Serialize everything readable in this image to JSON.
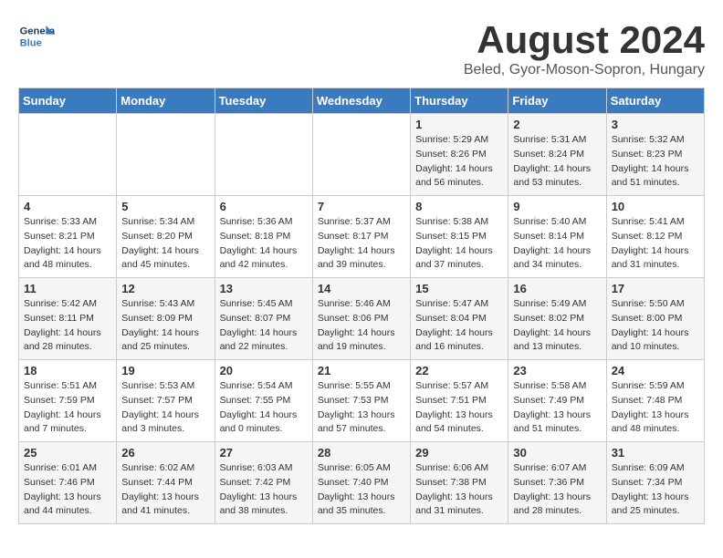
{
  "header": {
    "logo_line1": "General",
    "logo_line2": "Blue",
    "title": "August 2024",
    "subtitle": "Beled, Gyor-Moson-Sopron, Hungary"
  },
  "weekdays": [
    "Sunday",
    "Monday",
    "Tuesday",
    "Wednesday",
    "Thursday",
    "Friday",
    "Saturday"
  ],
  "weeks": [
    [
      {
        "day": "",
        "info": ""
      },
      {
        "day": "",
        "info": ""
      },
      {
        "day": "",
        "info": ""
      },
      {
        "day": "",
        "info": ""
      },
      {
        "day": "1",
        "info": "Sunrise: 5:29 AM\nSunset: 8:26 PM\nDaylight: 14 hours\nand 56 minutes."
      },
      {
        "day": "2",
        "info": "Sunrise: 5:31 AM\nSunset: 8:24 PM\nDaylight: 14 hours\nand 53 minutes."
      },
      {
        "day": "3",
        "info": "Sunrise: 5:32 AM\nSunset: 8:23 PM\nDaylight: 14 hours\nand 51 minutes."
      }
    ],
    [
      {
        "day": "4",
        "info": "Sunrise: 5:33 AM\nSunset: 8:21 PM\nDaylight: 14 hours\nand 48 minutes."
      },
      {
        "day": "5",
        "info": "Sunrise: 5:34 AM\nSunset: 8:20 PM\nDaylight: 14 hours\nand 45 minutes."
      },
      {
        "day": "6",
        "info": "Sunrise: 5:36 AM\nSunset: 8:18 PM\nDaylight: 14 hours\nand 42 minutes."
      },
      {
        "day": "7",
        "info": "Sunrise: 5:37 AM\nSunset: 8:17 PM\nDaylight: 14 hours\nand 39 minutes."
      },
      {
        "day": "8",
        "info": "Sunrise: 5:38 AM\nSunset: 8:15 PM\nDaylight: 14 hours\nand 37 minutes."
      },
      {
        "day": "9",
        "info": "Sunrise: 5:40 AM\nSunset: 8:14 PM\nDaylight: 14 hours\nand 34 minutes."
      },
      {
        "day": "10",
        "info": "Sunrise: 5:41 AM\nSunset: 8:12 PM\nDaylight: 14 hours\nand 31 minutes."
      }
    ],
    [
      {
        "day": "11",
        "info": "Sunrise: 5:42 AM\nSunset: 8:11 PM\nDaylight: 14 hours\nand 28 minutes."
      },
      {
        "day": "12",
        "info": "Sunrise: 5:43 AM\nSunset: 8:09 PM\nDaylight: 14 hours\nand 25 minutes."
      },
      {
        "day": "13",
        "info": "Sunrise: 5:45 AM\nSunset: 8:07 PM\nDaylight: 14 hours\nand 22 minutes."
      },
      {
        "day": "14",
        "info": "Sunrise: 5:46 AM\nSunset: 8:06 PM\nDaylight: 14 hours\nand 19 minutes."
      },
      {
        "day": "15",
        "info": "Sunrise: 5:47 AM\nSunset: 8:04 PM\nDaylight: 14 hours\nand 16 minutes."
      },
      {
        "day": "16",
        "info": "Sunrise: 5:49 AM\nSunset: 8:02 PM\nDaylight: 14 hours\nand 13 minutes."
      },
      {
        "day": "17",
        "info": "Sunrise: 5:50 AM\nSunset: 8:00 PM\nDaylight: 14 hours\nand 10 minutes."
      }
    ],
    [
      {
        "day": "18",
        "info": "Sunrise: 5:51 AM\nSunset: 7:59 PM\nDaylight: 14 hours\nand 7 minutes."
      },
      {
        "day": "19",
        "info": "Sunrise: 5:53 AM\nSunset: 7:57 PM\nDaylight: 14 hours\nand 3 minutes."
      },
      {
        "day": "20",
        "info": "Sunrise: 5:54 AM\nSunset: 7:55 PM\nDaylight: 14 hours\nand 0 minutes."
      },
      {
        "day": "21",
        "info": "Sunrise: 5:55 AM\nSunset: 7:53 PM\nDaylight: 13 hours\nand 57 minutes."
      },
      {
        "day": "22",
        "info": "Sunrise: 5:57 AM\nSunset: 7:51 PM\nDaylight: 13 hours\nand 54 minutes."
      },
      {
        "day": "23",
        "info": "Sunrise: 5:58 AM\nSunset: 7:49 PM\nDaylight: 13 hours\nand 51 minutes."
      },
      {
        "day": "24",
        "info": "Sunrise: 5:59 AM\nSunset: 7:48 PM\nDaylight: 13 hours\nand 48 minutes."
      }
    ],
    [
      {
        "day": "25",
        "info": "Sunrise: 6:01 AM\nSunset: 7:46 PM\nDaylight: 13 hours\nand 44 minutes."
      },
      {
        "day": "26",
        "info": "Sunrise: 6:02 AM\nSunset: 7:44 PM\nDaylight: 13 hours\nand 41 minutes."
      },
      {
        "day": "27",
        "info": "Sunrise: 6:03 AM\nSunset: 7:42 PM\nDaylight: 13 hours\nand 38 minutes."
      },
      {
        "day": "28",
        "info": "Sunrise: 6:05 AM\nSunset: 7:40 PM\nDaylight: 13 hours\nand 35 minutes."
      },
      {
        "day": "29",
        "info": "Sunrise: 6:06 AM\nSunset: 7:38 PM\nDaylight: 13 hours\nand 31 minutes."
      },
      {
        "day": "30",
        "info": "Sunrise: 6:07 AM\nSunset: 7:36 PM\nDaylight: 13 hours\nand 28 minutes."
      },
      {
        "day": "31",
        "info": "Sunrise: 6:09 AM\nSunset: 7:34 PM\nDaylight: 13 hours\nand 25 minutes."
      }
    ]
  ]
}
